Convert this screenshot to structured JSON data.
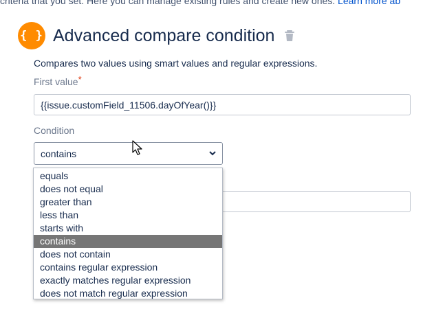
{
  "intro": {
    "text": "criteria that you set. Here you can manage existing rules and create new ones.",
    "link": "Learn more ab"
  },
  "header": {
    "icon_glyph": "{ }",
    "title": "Advanced compare condition"
  },
  "description": "Compares two values using smart values and regular expressions.",
  "first_value": {
    "label": "First value",
    "required_mark": "*",
    "value": "{{issue.customField_11506.dayOfYear()}}"
  },
  "condition": {
    "label": "Condition",
    "selected": "contains",
    "options": [
      "equals",
      "does not equal",
      "greater than",
      "less than",
      "starts with",
      "contains",
      "does not contain",
      "contains regular expression",
      "exactly matches regular expression",
      "does not match regular expression"
    ],
    "highlighted_index": 5
  },
  "second_value": {
    "value": ""
  },
  "colors": {
    "accent": "#ff8b00",
    "link": "#0052cc",
    "highlight": "#767676"
  }
}
